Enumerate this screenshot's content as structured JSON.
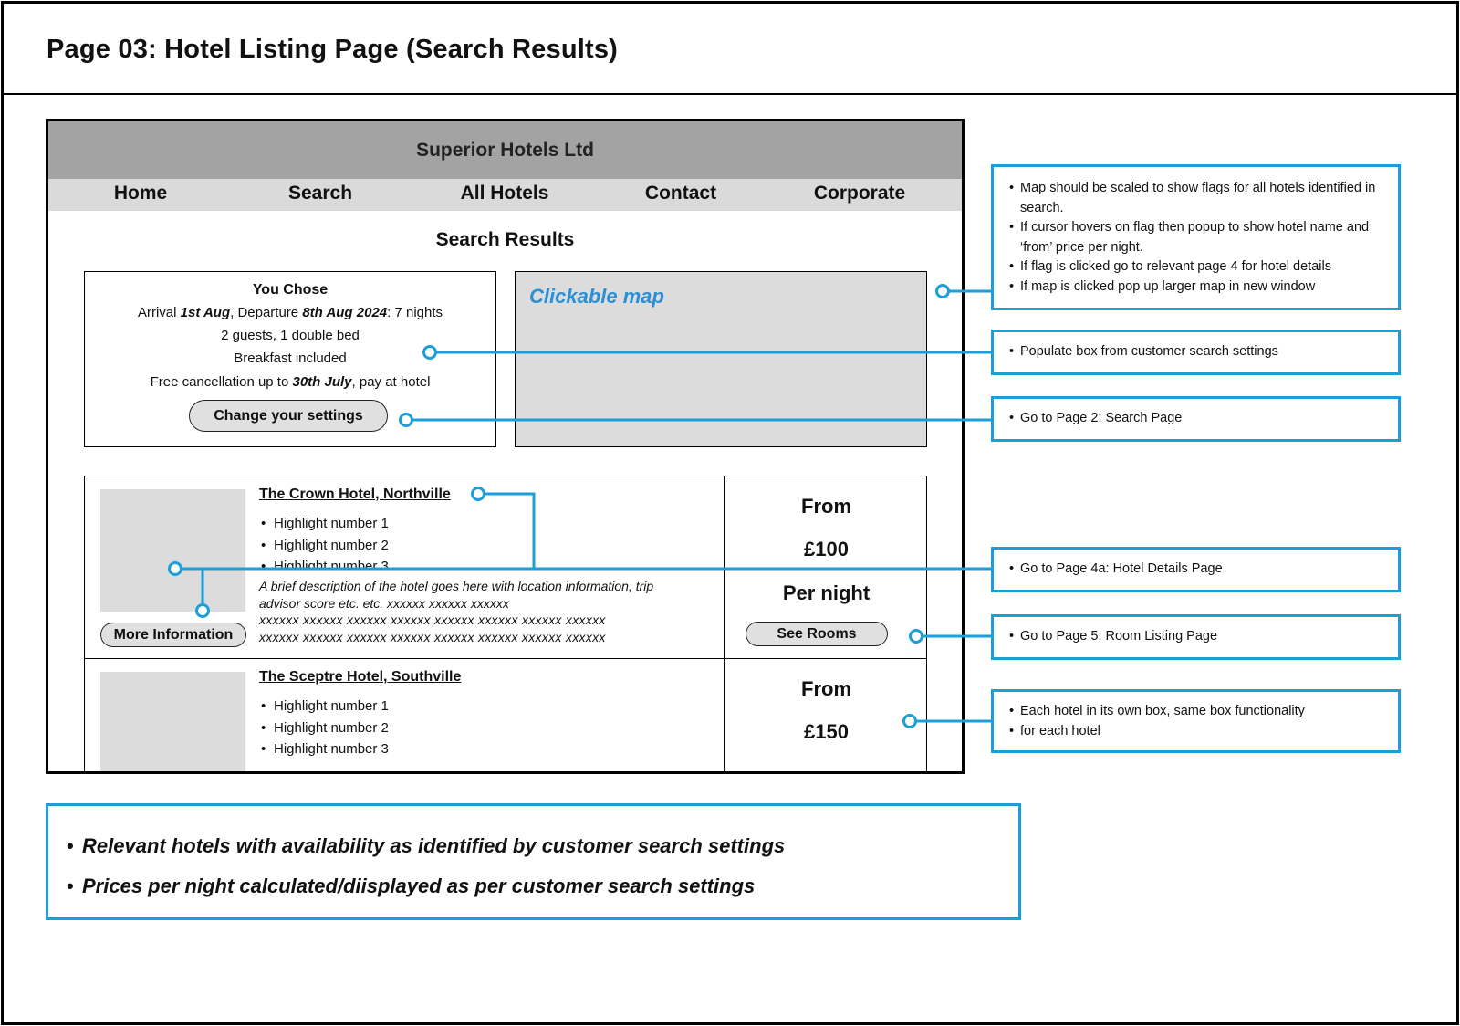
{
  "page": {
    "title": "Page 03: Hotel Listing Page (Search Results)"
  },
  "site": {
    "name": "Superior Hotels Ltd",
    "nav": [
      "Home",
      "Search",
      "All Hotels",
      "Contact",
      "Corporate"
    ],
    "results_heading": "Search Results"
  },
  "you_chose": {
    "title": "You Chose",
    "arrival_prefix": "Arrival ",
    "arrival_date": "1st Aug",
    "departure_prefix": ", Departure ",
    "departure_date": "8th Aug 2024",
    "nights": ": 7 nights",
    "guests": "2 guests, 1 double bed",
    "board": "Breakfast included",
    "cancel_prefix": "Free cancellation up to ",
    "cancel_date": "30th July",
    "cancel_suffix": ", pay at hotel",
    "change_button": "Change your settings"
  },
  "map": {
    "label": "Clickable map"
  },
  "hotels": [
    {
      "name": "The Crown Hotel, Northville",
      "highlights": [
        "Highlight number 1",
        "Highlight number 2",
        "Highlight number 3"
      ],
      "description": "A brief description of the hotel goes here with location information, trip advisor score etc. etc. xxxxxx xxxxxx xxxxxx",
      "description_extra_1": "xxxxxx xxxxxx xxxxxx xxxxxx xxxxxx xxxxxx xxxxxx xxxxxx",
      "description_extra_2": "xxxxxx  xxxxxx  xxxxxx  xxxxxx  xxxxxx  xxxxxx  xxxxxx  xxxxxx",
      "more_button": "More Information",
      "price_from": "From",
      "price": "£100",
      "per_night": "Per night",
      "rooms_button": "See Rooms"
    },
    {
      "name": "The Sceptre Hotel, Southville",
      "highlights": [
        "Highlight number 1",
        "Highlight number 2",
        "Highlight number 3"
      ],
      "price_from": "From",
      "price": "£150"
    }
  ],
  "annotations": {
    "map_notes": [
      "Map should be scaled to show flags for all hotels identified in search.",
      "If cursor hovers on flag then popup to show hotel name and ‘from’ price per night.",
      "If flag is clicked go to relevant page 4 for hotel details",
      "If map is clicked pop up larger map in new window"
    ],
    "populate_note": "Populate box from customer search settings",
    "search_page_note": "Go to Page 2: Search Page",
    "hotel_details_note": "Go to Page 4a: Hotel Details Page",
    "room_listing_note": "Go to Page 5: Room Listing Page",
    "each_hotel_notes": [
      "Each hotel in its own box, same box functionality",
      "for each hotel"
    ]
  },
  "bottom_notes": [
    "Relevant hotels with availability as identified by customer search settings",
    "Prices per night calculated/diisplayed as per customer search settings"
  ],
  "colors": {
    "annotation_blue": "#1a9fd8",
    "map_label_blue": "#2a8fd6",
    "header_grey": "#a3a3a3",
    "nav_grey": "#dadada"
  }
}
